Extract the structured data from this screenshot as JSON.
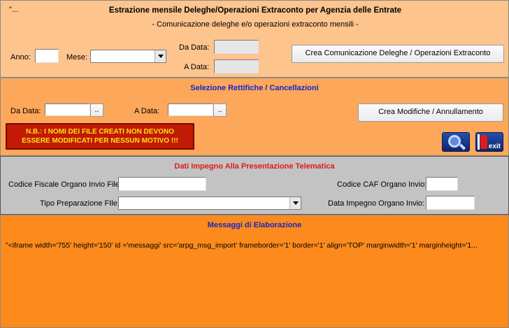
{
  "header": {
    "corner_text": "\"...",
    "title": "Estrazione mensile Deleghe/Operazioni Extraconto per Agenzia delle Entrate",
    "subtitle": "- Comunicazione deleghe e/o operazioni extraconto mensili -"
  },
  "section1": {
    "anno_label": "Anno:",
    "anno_value": "",
    "mese_label": "Mese:",
    "mese_value": "",
    "da_data_label": "Da Data:",
    "da_data_value": "",
    "a_data_label": "A Data:",
    "a_data_value": "",
    "crea_button": "Crea Comunicazione Deleghe / Operazioni Extraconto"
  },
  "section2": {
    "title": "Selezione Rettifiche / Cancellazioni",
    "da_data_label": "Da Data:",
    "da_data_value": "",
    "a_data_label": "A Data:",
    "a_data_value": "",
    "picker_label": "..",
    "crea_button": "Crea Modifiche / Annullamento",
    "warning_line1": "N.B.: I NOMI DEI FILE CREATI NON DEVONO",
    "warning_line2": "ESSERE MODIFICATI PER NESSUN MOTIVO !!!",
    "exit_label": "exit",
    "icons": {
      "search": "magnifier-icon",
      "exit": "exit-door-icon"
    }
  },
  "section3": {
    "title": "Dati Impegno Alla Presentazione Telematica",
    "codice_fiscale_label": "Codice Fiscale Organo Invio File:",
    "codice_fiscale_value": "",
    "codice_caf_label": "Codice CAF Organo Invio:",
    "codice_caf_value": "",
    "tipo_prep_label": "Tipo Preparazione FIle:",
    "tipo_prep_value": "",
    "data_impegno_label": "Data Impegno Organo Invio:",
    "data_impegno_value": ""
  },
  "section4": {
    "title": "Messaggi di Elaborazione",
    "message": "\"<iframe width='755' height='150' id ='messaggi' src='arpg_msg_import' frameborder='1'  border='1' align='TOP' marginwidth='1' marginheight='1..."
  },
  "colors": {
    "panel1": "#fdc48e",
    "panel2": "#fca759",
    "panel3": "#c3c3c3",
    "panel4": "#fd8a1c",
    "title_blue": "#1428c8",
    "title_red": "#e01a1a",
    "warning_bg": "#c11a05",
    "warning_text": "#ffe01a"
  }
}
